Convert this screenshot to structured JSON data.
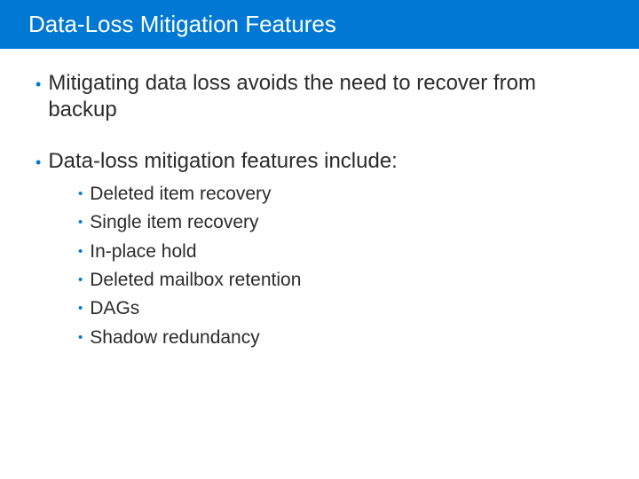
{
  "header": {
    "title": "Data-Loss Mitigation Features"
  },
  "bullets": [
    {
      "text": "Mitigating data loss avoids the need to recover from backup"
    },
    {
      "text": "Data-loss mitigation features include:"
    }
  ],
  "subBullets": [
    "Deleted item recovery",
    "Single item recovery",
    "In-place hold",
    "Deleted mailbox retention",
    "DAGs",
    "Shadow redundancy"
  ]
}
